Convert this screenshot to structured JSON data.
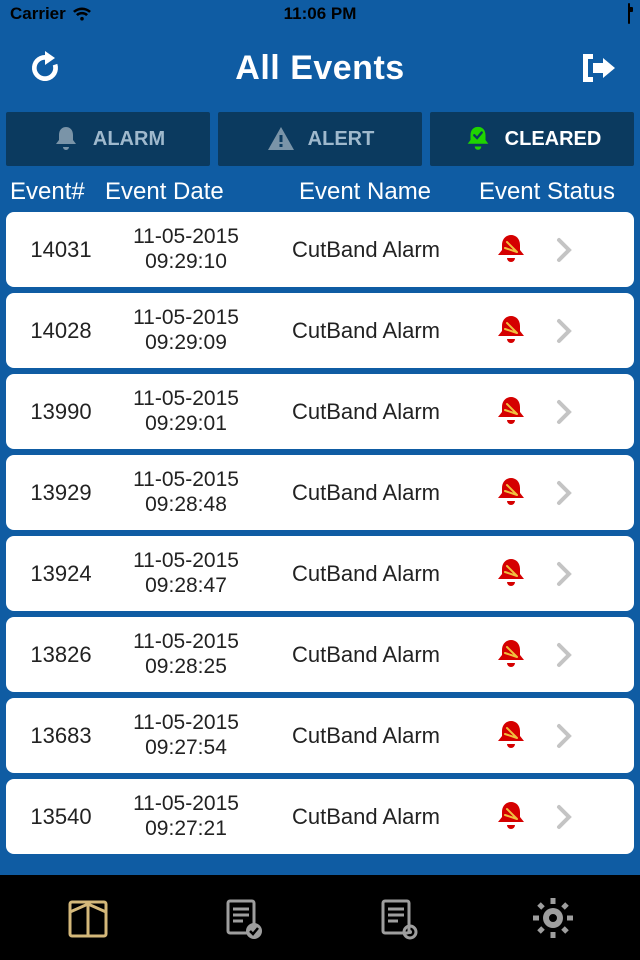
{
  "statusbar": {
    "carrier": "Carrier",
    "time": "11:06 PM"
  },
  "nav": {
    "title": "All Events"
  },
  "filters": {
    "alarm": "ALARM",
    "alert": "ALERT",
    "cleared": "CLEARED"
  },
  "columns": {
    "c1": "Event#",
    "c2": "Event Date",
    "c3": "Event Name",
    "c4": "Event Status"
  },
  "events": [
    {
      "id": "14031",
      "date": "11-05-2015",
      "time": "09:29:10",
      "name": "CutBand Alarm"
    },
    {
      "id": "14028",
      "date": "11-05-2015",
      "time": "09:29:09",
      "name": "CutBand Alarm"
    },
    {
      "id": "13990",
      "date": "11-05-2015",
      "time": "09:29:01",
      "name": "CutBand Alarm"
    },
    {
      "id": "13929",
      "date": "11-05-2015",
      "time": "09:28:48",
      "name": "CutBand Alarm"
    },
    {
      "id": "13924",
      "date": "11-05-2015",
      "time": "09:28:47",
      "name": "CutBand Alarm"
    },
    {
      "id": "13826",
      "date": "11-05-2015",
      "time": "09:28:25",
      "name": "CutBand Alarm"
    },
    {
      "id": "13683",
      "date": "11-05-2015",
      "time": "09:27:54",
      "name": "CutBand Alarm"
    },
    {
      "id": "13540",
      "date": "11-05-2015",
      "time": "09:27:21",
      "name": "CutBand Alarm"
    }
  ]
}
